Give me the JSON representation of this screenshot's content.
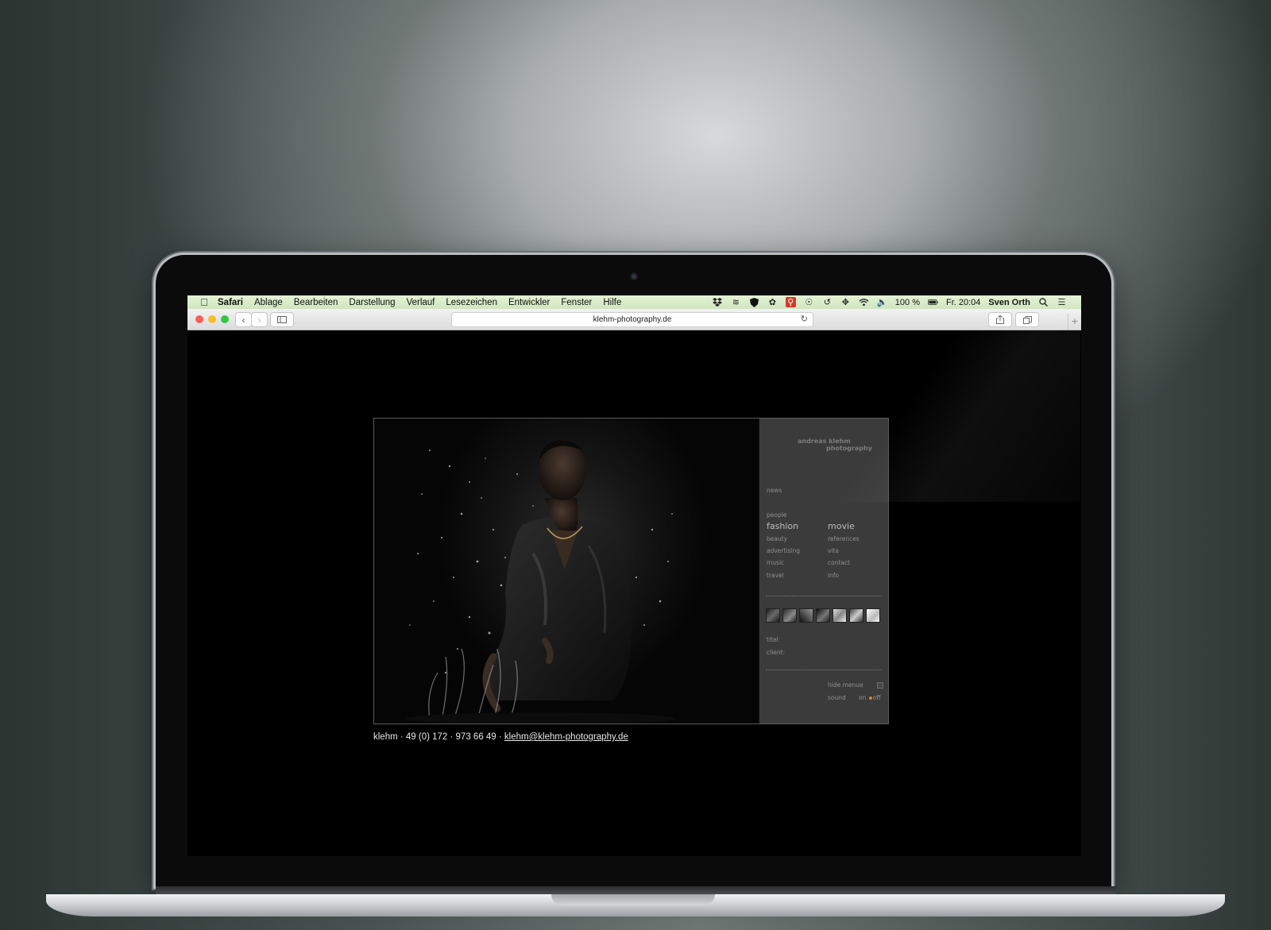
{
  "menubar": {
    "items": [
      "Safari",
      "Ablage",
      "Bearbeiten",
      "Darstellung",
      "Verlauf",
      "Lesezeichen",
      "Entwickler",
      "Fenster",
      "Hilfe"
    ],
    "battery": "100 %",
    "clock": "Fr. 20:04",
    "user": "Sven Orth",
    "accent": "#d6ecc6"
  },
  "browser": {
    "url": "klehm-photography.de"
  },
  "site": {
    "logo_line1": "andreas klehm",
    "logo_line2": "photography",
    "nav": {
      "news": "news",
      "people": "people",
      "fashion": "fashion",
      "movie": "movie",
      "beauty": "beauty",
      "references": "references",
      "advertising": "advertising",
      "vita": "vita",
      "music": "music",
      "contact": "contact",
      "travel": "travel",
      "info": "info"
    },
    "meta": {
      "titel": "titel:",
      "client": "client:"
    },
    "controls": {
      "hide_menue": "hide menue",
      "sound": "sound",
      "on": "on",
      "off": "off"
    },
    "footer_text": "klehm · 49 (0) 172 · 973 66 49 · ",
    "footer_email": "klehm@klehm-photography.de"
  }
}
